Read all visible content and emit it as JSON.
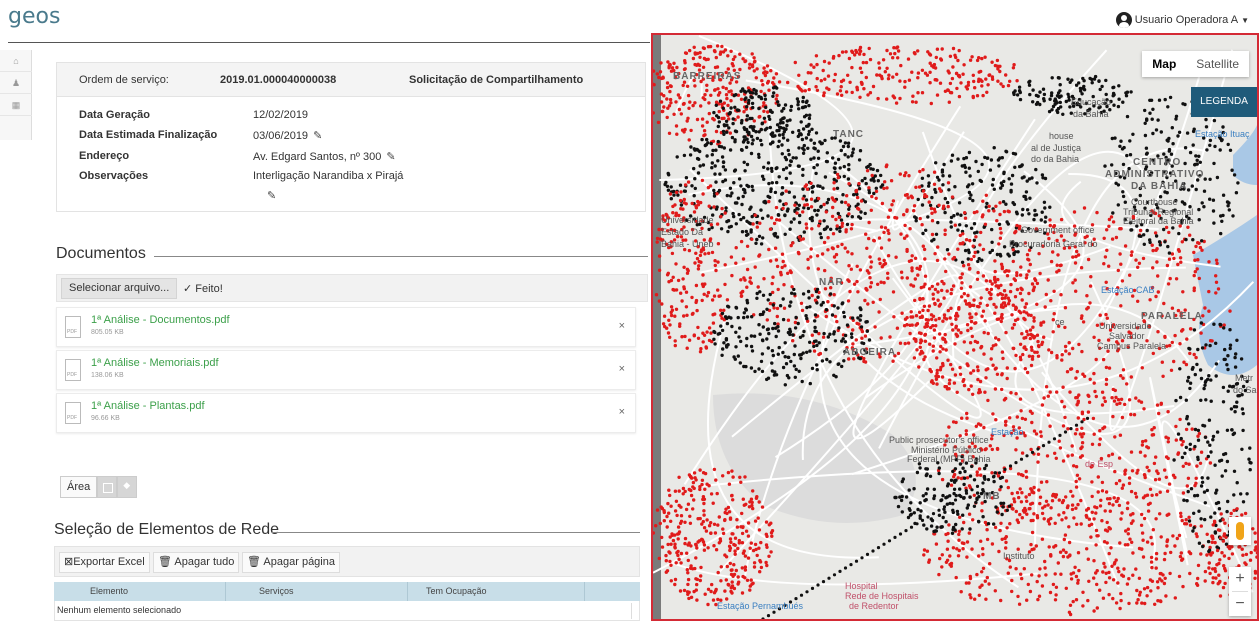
{
  "header": {
    "logo": "geos",
    "user_label": "Usuario Operadora A"
  },
  "rail": [
    "⌂",
    "♟",
    "▦"
  ],
  "ordem": {
    "label": "Ordem de serviço:",
    "number": "2019.01.000040000038",
    "type": "Solicitação de Compartilhamento",
    "fields": [
      {
        "key": "Data Geração",
        "value": "12/02/2019",
        "editable": false
      },
      {
        "key": "Data Estimada Finalização",
        "value": "03/06/2019",
        "editable": true
      },
      {
        "key": "Endereço",
        "value": "Av. Edgard Santos, nº 300",
        "editable": true
      },
      {
        "key": "Observações",
        "value": "Interligação Narandiba x Pirajá",
        "editable": true
      }
    ]
  },
  "documentos": {
    "title": "Documentos",
    "select_button": "Selecionar arquivo...",
    "done_label": "✓ Feito!",
    "files": [
      {
        "name": "1ª Análise - Documentos.pdf",
        "size": "805.05 KB"
      },
      {
        "name": "1ª Análise - Memoriais.pdf",
        "size": "138.06 KB"
      },
      {
        "name": "1ª Análise - Plantas.pdf",
        "size": "96.66 KB"
      }
    ],
    "remove_glyph": "×"
  },
  "area": {
    "label": "Área"
  },
  "rede": {
    "title": "Seleção de Elementos de Rede",
    "buttons": [
      "Exportar Excel",
      "Apagar tudo",
      "Apagar página"
    ],
    "columns": [
      "Elemento",
      "Serviços",
      "Tem Ocupação"
    ],
    "empty_text": "Nenhum elemento selecionado"
  },
  "map": {
    "map_button": "Map",
    "satellite_button": "Satellite",
    "legend_button": "LEGENDA",
    "zoom_in": "+",
    "zoom_out": "−",
    "labels": {
      "barreiras": "BARREIRAS",
      "tanc": "TANC",
      "educacao": "Educação",
      "bahia": "da Bahia",
      "house": "house",
      "justica": "al de Justiça",
      "bahia2": "do da Bahia",
      "estacao_ituacu": "Estação Ituaç",
      "centro": "CENTRO",
      "administrativo": "ADMINISTRATIVO",
      "dabahia": "DA BAHIA",
      "courthouse": "Courthouse",
      "tribunal": "Tribunal Regional",
      "eleitoral": "Eleitoral da Bahia",
      "universidade": "Universidade",
      "estado": "Estado Da",
      "bahia_uneb": "Bahia - Uneb",
      "government": "Government office",
      "procuradoria": "Procuradoria Geral do",
      "nar": "NAR",
      "estacao_cab": "Estação CAB",
      "paralela": "PARALELA",
      "univ_salv": "Universidade",
      "salvador": "Salvador",
      "campus": "Campus Paralela",
      "aboeira": "ABOEIRA",
      "ce": "ce",
      "metr": "Metr",
      "do_sal": "do Sal",
      "public_pros": "Public prosecutor's office",
      "ministerio": "Ministério Público",
      "federal": "Federal (MPF) Bahia",
      "mb": "MB",
      "estacao": "Estação",
      "hospital": "Hospital",
      "rede_hosp": "Rede de Hospitais",
      "redentor": "de Redentor",
      "instituto": "Instituto",
      "estacao_pernambues": "Estação Pernambués",
      "esp": "de Esp"
    }
  }
}
